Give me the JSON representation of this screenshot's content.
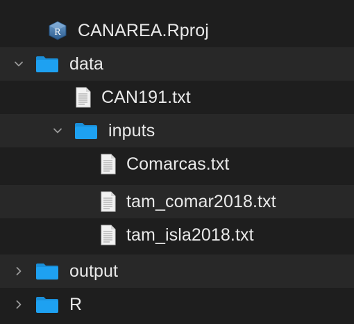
{
  "finder": {
    "items": [
      {
        "name": "CANAREA.Rproj",
        "kind": "rproj",
        "depth": 0,
        "expanded": null
      },
      {
        "name": "data",
        "kind": "folder",
        "depth": 0,
        "expanded": true
      },
      {
        "name": "CAN191.txt",
        "kind": "text-file",
        "depth": 1,
        "expanded": null
      },
      {
        "name": "inputs",
        "kind": "folder",
        "depth": 1,
        "expanded": true
      },
      {
        "name": "Comarcas.txt",
        "kind": "text-file",
        "depth": 2,
        "expanded": null
      },
      {
        "name": "tam_comar2018.txt",
        "kind": "text-file",
        "depth": 2,
        "expanded": null
      },
      {
        "name": "tam_isla2018.txt",
        "kind": "text-file",
        "depth": 2,
        "expanded": null
      },
      {
        "name": "output",
        "kind": "folder",
        "depth": 0,
        "expanded": false
      },
      {
        "name": "R",
        "kind": "folder",
        "depth": 0,
        "expanded": false
      }
    ]
  },
  "colors": {
    "background": "#1e1e1e",
    "row_alt": "#282828",
    "text": "#e9e9e9",
    "folder": "#1ea1f1",
    "chevron": "#9a9a9a"
  },
  "icons": {
    "folder": "folder-icon",
    "text-file": "text-file-icon",
    "rproj": "r-project-icon",
    "expanded": "chevron-down-icon",
    "collapsed": "chevron-right-icon"
  }
}
